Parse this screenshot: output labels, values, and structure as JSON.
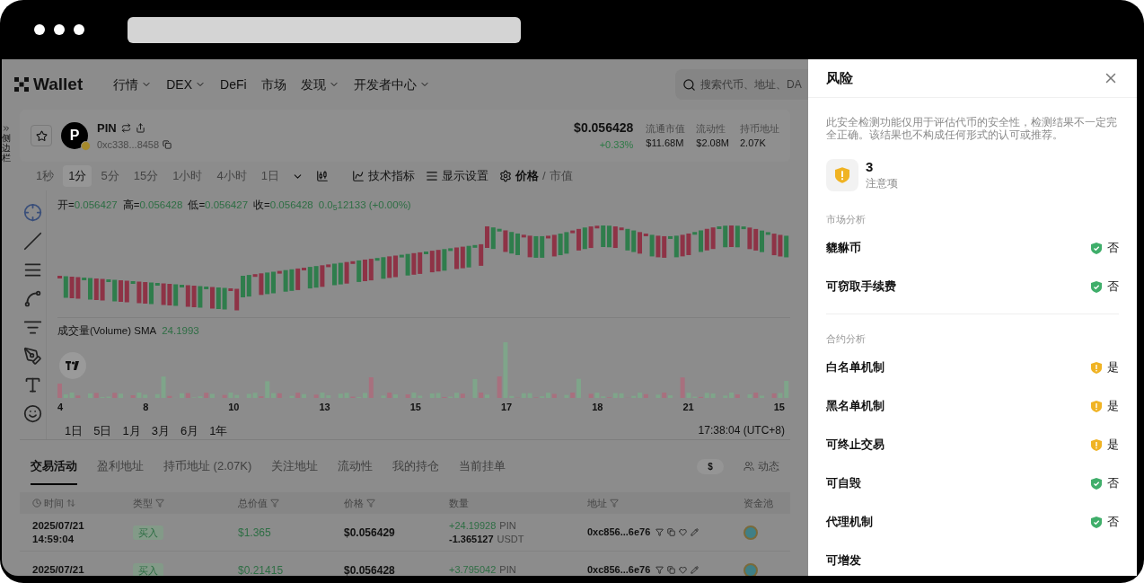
{
  "nav": {
    "logo": "Wallet",
    "items": [
      {
        "label": "行情",
        "dropdown": true
      },
      {
        "label": "DEX",
        "dropdown": true
      },
      {
        "label": "DeFi",
        "dropdown": false
      },
      {
        "label": "市场",
        "dropdown": false
      },
      {
        "label": "发现",
        "dropdown": true
      },
      {
        "label": "开发者中心",
        "dropdown": true
      }
    ],
    "search": {
      "placeholder": "搜索代币、地址、DA"
    }
  },
  "side_toggle": "侧边栏",
  "token": {
    "avatar": "P",
    "symbol": "PIN",
    "address": "0xc338...8458",
    "price": "$0.056428",
    "change": "+0.33%",
    "stats": [
      {
        "label": "流通市值",
        "value": "$11.68M"
      },
      {
        "label": "流动性",
        "value": "$2.08M"
      },
      {
        "label": "持币地址",
        "value": "2.07K"
      }
    ]
  },
  "intervals": [
    {
      "label": "1秒",
      "selected": false
    },
    {
      "label": "1分",
      "selected": true
    },
    {
      "label": "5分",
      "selected": false
    },
    {
      "label": "15分",
      "selected": false
    },
    {
      "label": "1小时",
      "selected": false
    },
    {
      "label": "4小时",
      "selected": false
    },
    {
      "label": "1日",
      "selected": false
    }
  ],
  "chart_tools": {
    "indicators": "技术指标",
    "display": "显示设置",
    "separator": "/",
    "modes": [
      {
        "label": "价格",
        "selected": true
      },
      {
        "label": "市值",
        "selected": false
      }
    ]
  },
  "ohlc": [
    {
      "label": "开=",
      "value": "0.056427"
    },
    {
      "label": "高=",
      "value": "0.056428"
    },
    {
      "label": "低=",
      "value": "0.056427"
    },
    {
      "label": "收=",
      "value": "0.056428"
    }
  ],
  "ohlc_change": "0.0$_{5}$12133 (+0.00%)",
  "volume": {
    "label": "成交量(Volume) SMA",
    "value": "24.1993"
  },
  "x_labels": [
    "4",
    "8",
    "10",
    "13",
    "15",
    "17",
    "18",
    "21",
    "15"
  ],
  "ranges": [
    "1日",
    "5日",
    "1月",
    "3月",
    "6月",
    "1年"
  ],
  "time": "17:38:04 (UTC+8)",
  "tabs": [
    {
      "label": "交易活动",
      "selected": true
    },
    {
      "label": "盈利地址",
      "selected": false
    },
    {
      "label": "持币地址 (2.07K)",
      "selected": false
    },
    {
      "label": "关注地址",
      "selected": false
    },
    {
      "label": "流动性",
      "selected": false
    },
    {
      "label": "我的持仓",
      "selected": false
    },
    {
      "label": "当前挂单",
      "selected": false
    }
  ],
  "currency": "$",
  "dynamic": "动态",
  "table": {
    "columns": [
      "时间",
      "类型",
      "总价值",
      "价格",
      "数量",
      "地址",
      "资金池"
    ],
    "rows": [
      {
        "date": "2025/07/21",
        "clock": "14:59:04",
        "type": "买入",
        "total": "$1.365",
        "price": "$0.056429",
        "in_amount": "+24.19928",
        "in_unit": "PIN",
        "out_amount": "-1.365127",
        "out_unit": "USDT",
        "address": "0xc856...6e76"
      },
      {
        "date": "2025/07/21",
        "type": "买入",
        "total": "$0.21415",
        "price": "$0.056428",
        "in_amount": "+3.795042",
        "in_unit": "PIN",
        "address": "0xc856...6e76"
      }
    ]
  },
  "risk_panel": {
    "title": "风险",
    "notice": "此安全检测功能仅用于评估代币的安全性，检测结果不一定完全正确。该结果也不构成任何形式的认可或推荐。",
    "count": "3",
    "count_label": "注意项",
    "sections": [
      {
        "title": "市场分析",
        "items": [
          {
            "label": "貔貅币",
            "value": "否",
            "flagged": false
          },
          {
            "label": "可窃取手续费",
            "value": "否",
            "flagged": false
          }
        ]
      },
      {
        "title": "合约分析",
        "items": [
          {
            "label": "白名单机制",
            "value": "是",
            "flagged": true
          },
          {
            "label": "黑名单机制",
            "value": "是",
            "flagged": true
          },
          {
            "label": "可终止交易",
            "value": "是",
            "flagged": true
          },
          {
            "label": "可自毁",
            "value": "否",
            "flagged": false
          },
          {
            "label": "代理机制",
            "value": "否",
            "flagged": false
          },
          {
            "label": "可增发"
          }
        ]
      }
    ]
  }
}
